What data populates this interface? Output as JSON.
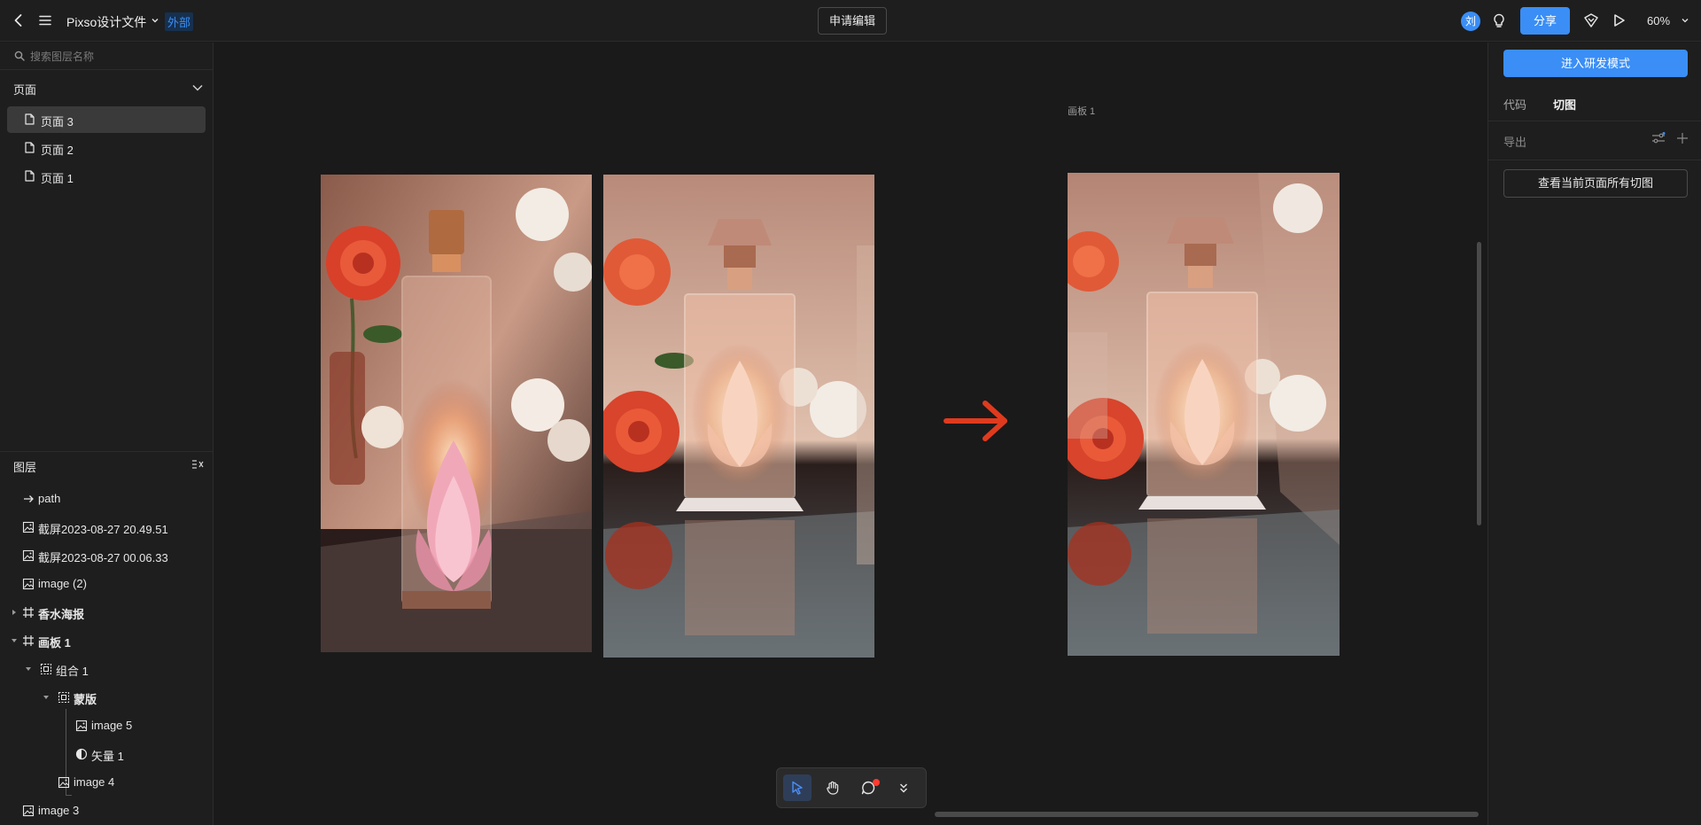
{
  "header": {
    "file_title": "Pixso设计文件",
    "badge": "外部",
    "request_edit": "申请编辑",
    "avatar": "刘",
    "share": "分享",
    "zoom": "60%"
  },
  "left_panel": {
    "search_placeholder": "搜索图层名称",
    "pages_heading": "页面",
    "pages": [
      {
        "label": "页面 3",
        "active": true
      },
      {
        "label": "页面 2",
        "active": false
      },
      {
        "label": "页面 1",
        "active": false
      }
    ],
    "layers_heading": "图层",
    "layers": [
      {
        "label": "path",
        "icon": "arrow-right-icon"
      },
      {
        "label": "截屏2023-08-27 20.49.51",
        "icon": "image-icon"
      },
      {
        "label": "截屏2023-08-27 00.06.33",
        "icon": "image-icon"
      },
      {
        "label": "image (2)",
        "icon": "image-icon"
      },
      {
        "label": "香水海报",
        "icon": "frame-icon"
      },
      {
        "label": "画板 1",
        "icon": "frame-icon"
      },
      {
        "label": "组合 1",
        "icon": "group-icon"
      },
      {
        "label": "蒙版",
        "icon": "group-icon"
      },
      {
        "label": "image 5",
        "icon": "image-icon"
      },
      {
        "label": "矢量 1",
        "icon": "mask-icon"
      },
      {
        "label": "image 4",
        "icon": "image-icon"
      },
      {
        "label": "image 3",
        "icon": "image-icon"
      }
    ]
  },
  "canvas": {
    "frame_label": "画板 1",
    "arrow_color": "#e03a1e"
  },
  "right_panel": {
    "dev_mode_button": "进入研发模式",
    "tabs": [
      {
        "label": "代码",
        "active": false
      },
      {
        "label": "切图",
        "active": true
      }
    ],
    "export_label": "导出",
    "view_all_slices": "查看当前页面所有切图"
  },
  "colors": {
    "accent": "#3a8ef6",
    "panel_bg": "#1e1e1e",
    "canvas_bg": "#1a1a1a"
  }
}
